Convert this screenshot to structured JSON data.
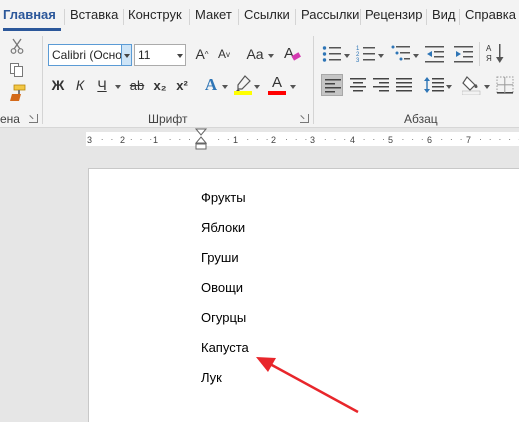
{
  "ribbon_tabs": [
    "Главная",
    "Вставка",
    "Конструк",
    "Макет",
    "Ссылки",
    "Рассылки",
    "Рецензир",
    "Вид",
    "Справка"
  ],
  "clipboard": {
    "label": "ена"
  },
  "font": {
    "name": "Calibri (Осно",
    "size": "11",
    "label": "Шрифт",
    "bold_label": "Ж",
    "italic_label": "К",
    "underline_label": "Ч",
    "strike_label": "ab",
    "subscript_label": "x₂",
    "superscript_label": "x²",
    "grow_label": "A",
    "shrink_label": "A",
    "case_label": "Aa",
    "effects_label": "A",
    "color_label": "A",
    "highlight_color": "#ffff00",
    "font_color": "#ff0000"
  },
  "paragraph": {
    "label": "Абзац"
  },
  "ruler": {
    "numbers": [
      "3",
      "2",
      "1",
      "1",
      "2",
      "3",
      "4",
      "5",
      "6",
      "7"
    ]
  },
  "document": {
    "lines": [
      "Фрукты",
      "Яблоки",
      "Груши",
      "Овощи",
      "Огурцы",
      "Капуста",
      "Лук"
    ]
  },
  "annotation": {
    "arrow_color": "#e8262b"
  },
  "colors": {
    "accent": "#2b579a",
    "selected_button": "#c5c5c5"
  }
}
